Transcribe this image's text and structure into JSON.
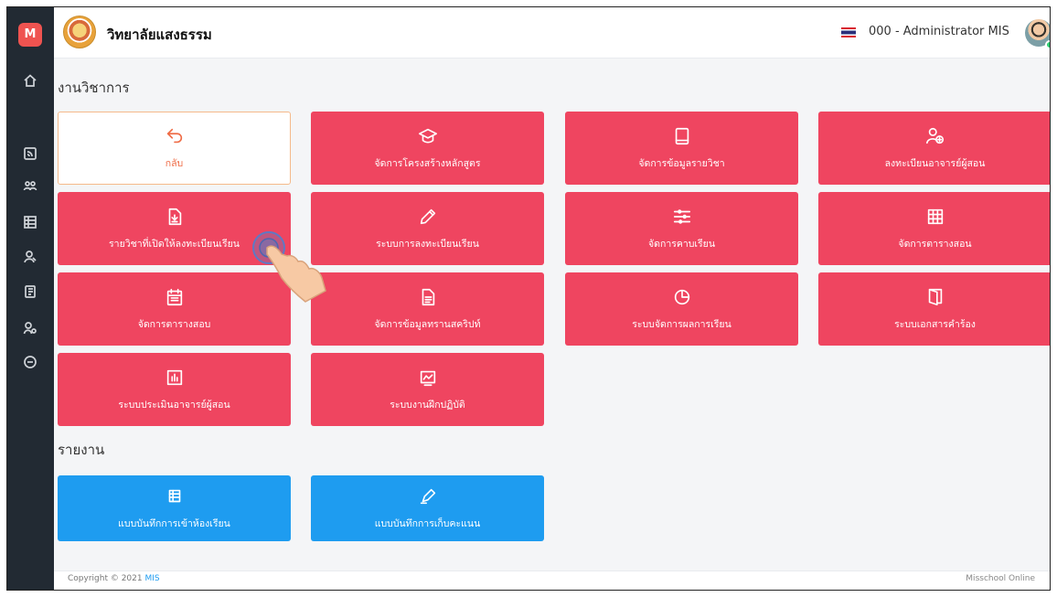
{
  "header": {
    "school_name": "วิทยาลัยแสงธรรม",
    "user_name": "000 - Administrator MIS"
  },
  "sidebar": {
    "logo_letter": "M",
    "items": [
      {
        "icon": "home-icon"
      },
      {
        "icon": "rss-icon"
      },
      {
        "icon": "users-icon"
      },
      {
        "icon": "table-icon"
      },
      {
        "icon": "user-icon"
      },
      {
        "icon": "book-icon"
      },
      {
        "icon": "user-settings-icon"
      },
      {
        "icon": "logout-icon"
      }
    ]
  },
  "sections": {
    "academic_title": "งานวิชาการ",
    "report_title": "รายงาน"
  },
  "tiles": {
    "back": "กลับ",
    "curriculum": "จัดการโครงสร้างหลักสูตร",
    "subjects": "จัดการข้อมูลรายวิชา",
    "register_teacher": "ลงทะเบียนอาจารย์ผู้สอน",
    "open_courses": "รายวิชาที่เปิดให้ลงทะเบียนเรียน",
    "registration_system": "ระบบการลงทะเบียนเรียน",
    "periods": "จัดการคาบเรียน",
    "teaching_schedule": "จัดการตารางสอน",
    "exam_schedule": "จัดการตารางสอบ",
    "transcript": "จัดการข้อมูลทรานสคริปท์",
    "grades": "ระบบจัดการผลการเรียน",
    "petitions": "ระบบเอกสารคำร้อง",
    "teacher_eval": "ระบบประเมินอาจารย์ผู้สอน",
    "internship": "ระบบงานฝึกปฏิบัติ",
    "attendance_report": "แบบบันทึกการเข้าห้องเรียน",
    "score_report": "แบบบันทึกการเก็บคะแนน"
  },
  "footer": {
    "copyright": "Copyright © 2021",
    "copyright_link": "MIS",
    "brand": "Misschool Online"
  },
  "colors": {
    "tile_red": "#ef4560",
    "tile_blue": "#1e9cf0",
    "sidebar": "#222a33",
    "back_accent": "#ef6b45"
  }
}
